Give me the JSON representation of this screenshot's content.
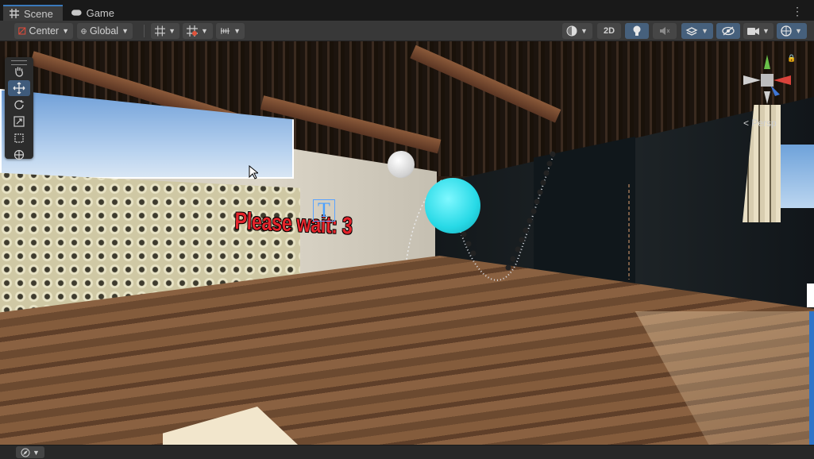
{
  "tabs": [
    {
      "label": "Scene",
      "icon": "grid-icon",
      "active": true
    },
    {
      "label": "Game",
      "icon": "gamepad-icon",
      "active": false
    }
  ],
  "toolbar": {
    "pivot_label": "Center",
    "space_label": "Global",
    "mode_2d_label": "2D"
  },
  "scene": {
    "countdown_text": "Please wait: 3",
    "persp_label": "< Persp"
  },
  "colors": {
    "accent": "#3a79bb",
    "countdown_text": "#e3242b",
    "cyan_ball": "#27d9e6"
  }
}
